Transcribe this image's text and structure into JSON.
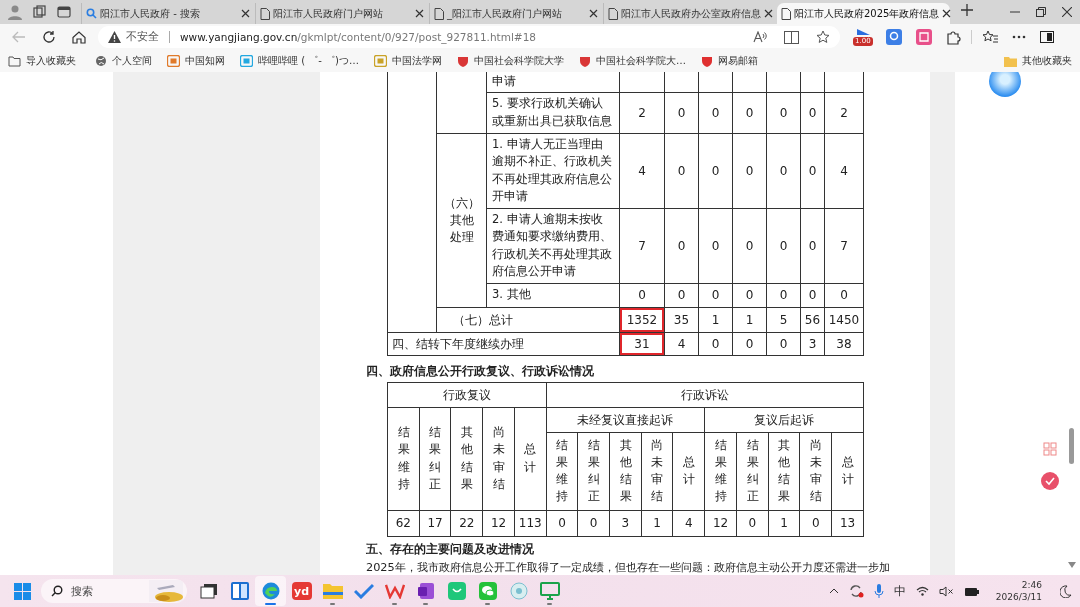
{
  "browser": {
    "tabs": [
      {
        "title": "阳江市人民政府 - 搜索",
        "kind": "search",
        "selected": false
      },
      {
        "title": "阳江市人民政府门户网站",
        "kind": "page",
        "selected": false
      },
      {
        "title": "_阳江市人民政府门户网站",
        "kind": "page",
        "selected": false
      },
      {
        "title": "阳江市人民政府办公室政府信息",
        "kind": "page",
        "selected": false
      },
      {
        "title": "阳江市人民政府2025年政府信息",
        "kind": "page",
        "selected": true
      }
    ],
    "back_disabled": true,
    "security": "不安全",
    "url_host": "www.yangjiang.gov.cn",
    "url_path": "/gkmlpt/content/0/927/post_927811.html#18",
    "extension_badge": "1.00",
    "bookmarks": [
      {
        "label": "导入收藏夹",
        "kind": "import"
      },
      {
        "label": "个人空间",
        "kind": "globe"
      },
      {
        "label": "中国知网",
        "kind": "cnki"
      },
      {
        "label": "哔哩哔哩 ( ゜- ゜)つ…",
        "kind": "tv"
      },
      {
        "label": "中国法学网",
        "kind": "law"
      },
      {
        "label": "中国社会科学院大学",
        "kind": "shield"
      },
      {
        "label": "中国社会科学院大…",
        "kind": "hat"
      },
      {
        "label": "网易邮箱",
        "kind": "mail"
      }
    ],
    "other_bookmarks": "其他收藏夹"
  },
  "document": {
    "table1": {
      "rows": [
        {
          "kind": "item",
          "item": "申请"
        },
        {
          "kind": "item",
          "item": "5. 要求行政机关确认或重新出具已获取信息",
          "values": [
            "2",
            "0",
            "0",
            "0",
            "0",
            "0",
            "2"
          ]
        },
        {
          "kind": "group",
          "label": "（六）其他处理",
          "items": [
            {
              "item": "1. 申请人无正当理由逾期不补正、行政机关不再处理其政府信息公开申请",
              "values": [
                "4",
                "0",
                "0",
                "0",
                "0",
                "0",
                "4"
              ]
            },
            {
              "item": "2. 申请人逾期未按收费通知要求缴纳费用、行政机关不再处理其政府信息公开申请",
              "values": [
                "7",
                "0",
                "0",
                "0",
                "0",
                "0",
                "7"
              ]
            },
            {
              "item": "3. 其他",
              "values": [
                "0",
                "0",
                "0",
                "0",
                "0",
                "0",
                "0"
              ]
            }
          ]
        },
        {
          "kind": "total",
          "label": "（七）总计",
          "values": [
            "1352",
            "35",
            "1",
            "1",
            "5",
            "56",
            "1450"
          ],
          "boxed": true
        },
        {
          "kind": "carry",
          "label": "四、结转下年度继续办理",
          "values": [
            "31",
            "4",
            "0",
            "0",
            "0",
            "3",
            "38"
          ],
          "boxed": true
        }
      ]
    },
    "section4_title": "四、政府信息公开行政复议、行政诉讼情况",
    "table2": {
      "review_header": "行政复议",
      "litigation_header": "行政诉讼",
      "direct_header": "未经复议直接起诉",
      "after_header": "复议后起诉",
      "review_columns": [
        "结果维持",
        "结果纠正",
        "其他结果",
        "尚未审结",
        "总计"
      ],
      "direct_columns": [
        "结果维持",
        "结果纠正",
        "其他结果",
        "尚未审结",
        "总计"
      ],
      "after_columns": [
        "结果维持",
        "结果纠正",
        "其他结果",
        "尚未审结",
        "总计"
      ],
      "values": [
        "62",
        "17",
        "22",
        "12",
        "113",
        "0",
        "0",
        "3",
        "1",
        "4",
        "12",
        "0",
        "1",
        "0",
        "13"
      ]
    },
    "section5_title": "五、存在的主要问题及改进情况",
    "paragraph": "2025年，我市政府信息公开工作取得了一定成绩，但也存在一些问题：政府信息主动公开力度还需进一步加"
  },
  "taskbar": {
    "search_placeholder": "搜索",
    "apps": [
      {
        "kind": "taskview",
        "running": false,
        "selected": false
      },
      {
        "kind": "widgets",
        "running": false,
        "selected": false
      },
      {
        "kind": "edge",
        "running": true,
        "selected": true
      },
      {
        "kind": "youdao",
        "label": "yd",
        "running": false,
        "selected": false
      },
      {
        "kind": "folder",
        "running": true,
        "selected": false
      },
      {
        "kind": "todo",
        "running": false,
        "selected": false
      },
      {
        "kind": "wps",
        "running": true,
        "selected": false
      },
      {
        "kind": "onenote",
        "running": true,
        "selected": false
      },
      {
        "kind": "bag",
        "running": false,
        "selected": false
      },
      {
        "kind": "wechat",
        "running": true,
        "selected": false
      },
      {
        "kind": "app",
        "running": false,
        "selected": false
      },
      {
        "kind": "monitor",
        "running": true,
        "selected": false
      }
    ],
    "ime": "中",
    "sound_muted": true,
    "time": "2:46",
    "date": "2026/3/11"
  }
}
